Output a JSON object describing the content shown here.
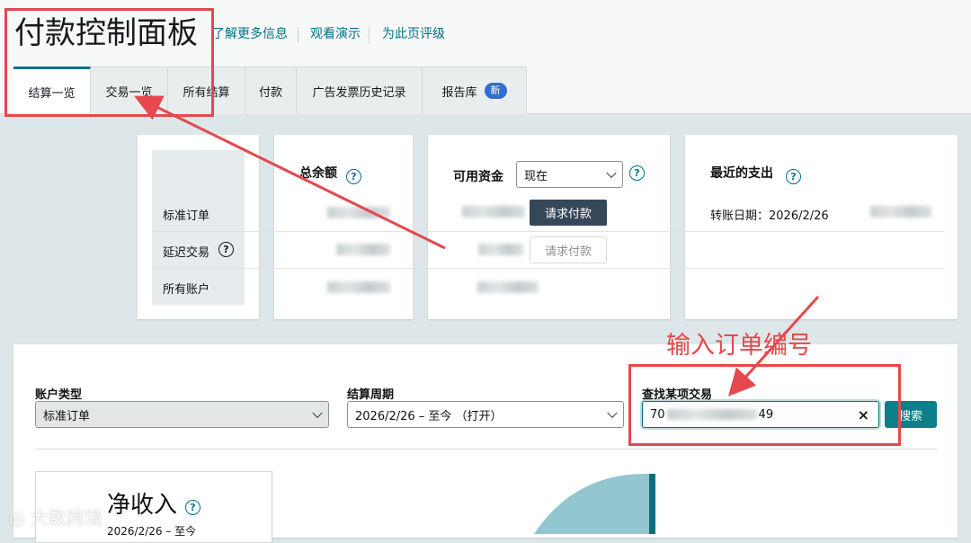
{
  "header": {
    "title": "付款控制面板",
    "links": [
      "了解更多信息",
      "观看演示",
      "为此页评级"
    ]
  },
  "tabs": [
    {
      "label": "结算一览",
      "active": true
    },
    {
      "label": "交易一览"
    },
    {
      "label": "所有结算"
    },
    {
      "label": "付款"
    },
    {
      "label": "广告发票历史记录"
    },
    {
      "label": "报告库",
      "badge": "新"
    }
  ],
  "summary": {
    "row_labels": [
      "标准订单",
      "延迟交易",
      "所有账户"
    ],
    "total_balance": {
      "title": "总余额"
    },
    "available_funds": {
      "title": "可用资金",
      "select_value": "现在",
      "request_button_primary": "请求付款",
      "request_button_secondary": "请求付款"
    },
    "recent_payout": {
      "title": "最近的支出",
      "transfer_date": "转账日期：2026/2/26"
    }
  },
  "filters": {
    "account_type": {
      "label": "账户类型",
      "value": "标准订单"
    },
    "settlement_period": {
      "label": "结算周期",
      "value": "2026/2/26 – 至今 （打开）"
    },
    "find_transaction": {
      "label": "查找某项交易",
      "value_prefix": "70",
      "value_suffix": "49",
      "clear": "×"
    },
    "search_button": "搜索"
  },
  "net_income": {
    "title": "净收入",
    "period": "2026/2/26 – 至今"
  },
  "annotation": "输入订单编号",
  "watermark": "大数跨境",
  "colors": {
    "accent": "#007185",
    "annotation": "#e5484d",
    "dark_button": "#37475a",
    "badge": "#2e6fd0"
  }
}
